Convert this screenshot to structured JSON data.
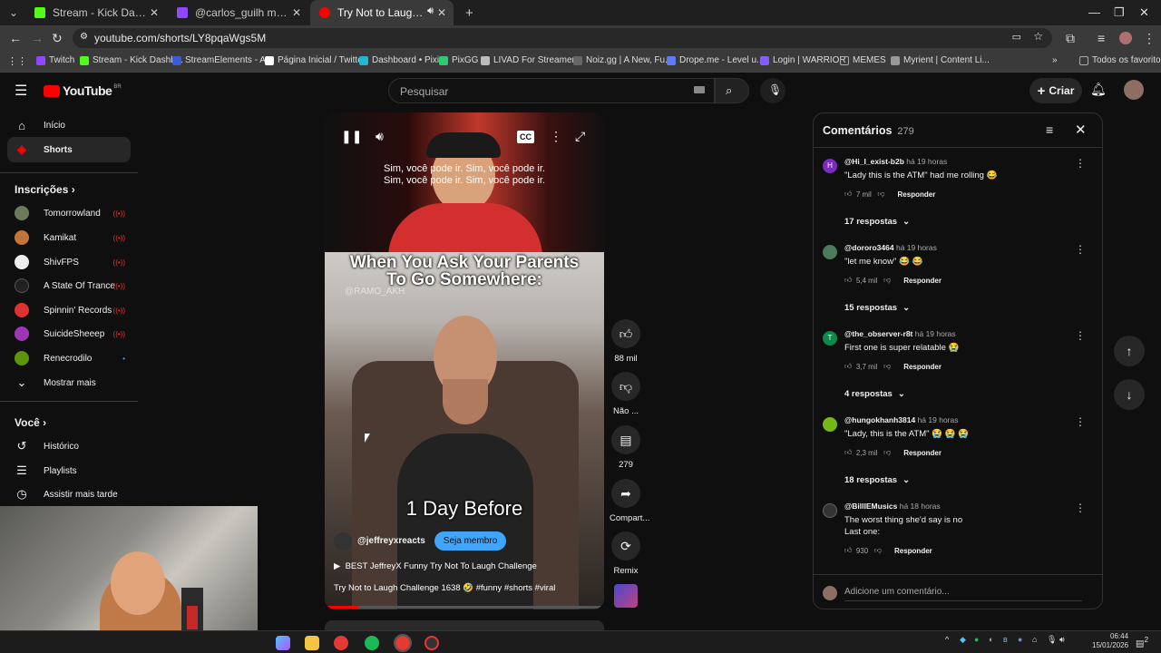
{
  "browser": {
    "tabs": [
      {
        "title": "Stream - Kick Dashboard",
        "color": "#53fc18"
      },
      {
        "title": "@carlos_guilh mentioned y",
        "color": "#9146ff"
      },
      {
        "title": "Try Not to Laugh Challenge",
        "color": "#ff0000"
      }
    ],
    "new_tab": "+",
    "url": "youtube.com/shorts/LY8pqaWgs5M",
    "bookmarks": [
      {
        "label": "Twitch",
        "color": "#9146ff"
      },
      {
        "label": "Stream - Kick Dashb...",
        "color": "#53fc18"
      },
      {
        "label": "StreamElements - A...",
        "color": "#3b5bdb"
      },
      {
        "label": "Página Inicial / Twitter",
        "color": "#ffffff"
      },
      {
        "label": "Dashboard • Pixie",
        "color": "#22b8cf"
      },
      {
        "label": "PixGG",
        "color": "#2ecc71"
      },
      {
        "label": "LIVAD For Streamer...",
        "color": "#bbbbbb"
      },
      {
        "label": "Noiz.gg | A New, Fu...",
        "color": "#666666"
      },
      {
        "label": "Drope.me - Level u...",
        "color": "#5c7cfa"
      },
      {
        "label": "Login | WARRIOR",
        "color": "#845ef7"
      },
      {
        "label": "MEMES",
        "color": "#aaaaaa"
      },
      {
        "label": "Myrient | Content Li...",
        "color": "#999999"
      }
    ],
    "all_favorites": "Todos os favoritos"
  },
  "youtube": {
    "logo_text": "YouTube",
    "region": "BR",
    "search_placeholder": "Pesquisar",
    "create_label": "Criar"
  },
  "sidebar": {
    "main": [
      {
        "label": "Início",
        "icon": "home-icon"
      },
      {
        "label": "Shorts",
        "icon": "shorts-icon"
      }
    ],
    "subs_heading": "Inscrições",
    "subs": [
      {
        "label": "Tomorrowland",
        "color": "#6d7a5a",
        "live": true
      },
      {
        "label": "Kamikat",
        "color": "#c0763a",
        "live": true
      },
      {
        "label": "ShivFPS",
        "color": "#eeeeee",
        "live": true
      },
      {
        "label": "A State Of Trance",
        "color": "#222222",
        "live": true
      },
      {
        "label": "Spinnin' Records",
        "color": "#e03131",
        "live": true
      },
      {
        "label": "SuicideSheeep",
        "color": "#9c36b5",
        "live": true
      },
      {
        "label": "Renecrodilo",
        "color": "#5c940d",
        "live": false
      }
    ],
    "show_more": "Mostrar mais",
    "you_heading": "Você",
    "you": [
      {
        "label": "Histórico",
        "icon": "history-icon"
      },
      {
        "label": "Playlists",
        "icon": "playlists-icon"
      },
      {
        "label": "Assistir mais tarde",
        "icon": "watch-later-icon"
      }
    ]
  },
  "short": {
    "captions": [
      "Sim, você pode ir.  Sim, você pode ir.",
      "Sim, você pode ir.  Sim, você pode ir."
    ],
    "title_overlay": "When You Ask Your Parents To Go Somewhere:",
    "watermark": "@RAMO_AKH",
    "bottom_overlay": "1 Day Before",
    "channel": "@jeffreyxreacts",
    "member_button": "Seja membro",
    "playlist": "BEST JeffreyX Funny Try Not To Laugh Challenge",
    "description": "Try Not to Laugh Challenge 1638 🤣 #funny #shorts #viral",
    "progress": 0.12
  },
  "actions": {
    "likes": "88 mil",
    "dislike": "Não ...",
    "comments": "279",
    "share": "Compart...",
    "remix": "Remix"
  },
  "comments_panel": {
    "title": "Comentários",
    "count": "279",
    "reply_label": "Responder",
    "items": [
      {
        "user": "@Hi_I_exist-b2b",
        "time": "há 19 horas",
        "text": "\"Lady this is the ATM\" had me rolling 😂",
        "likes": "7 mil",
        "replies": "17 respostas",
        "avatar": "H",
        "color": "#7b2cbf"
      },
      {
        "user": "@dororo3464",
        "time": "há 19 horas",
        "text": "\"let me know\" 😂 😂",
        "likes": "5,4 mil",
        "replies": "15 respostas",
        "avatar": "",
        "color": "#4a7c59"
      },
      {
        "user": "@the_observer-r8t",
        "time": "há 19 horas",
        "text": "First one is super relatable 😭",
        "likes": "3,7 mil",
        "replies": "4 respostas",
        "avatar": "T",
        "color": "#0b8a4a"
      },
      {
        "user": "@hungokhanh3814",
        "time": "há 19 horas",
        "text": "\"Lady, this is the ATM\" 😭 😭 😭",
        "likes": "2,3 mil",
        "replies": "18 respostas",
        "avatar": "",
        "color": "#74b816"
      },
      {
        "user": "@BillIEMusics",
        "time": "há 18 horas",
        "text": "The worst thing she'd say is no\nLast one:",
        "likes": "930",
        "replies": "",
        "avatar": "",
        "color": "#333333"
      }
    ],
    "add_placeholder": "Adicione um comentário..."
  },
  "taskbar": {
    "time": "06:44",
    "date": "15/01/2026",
    "notifications": "2"
  }
}
